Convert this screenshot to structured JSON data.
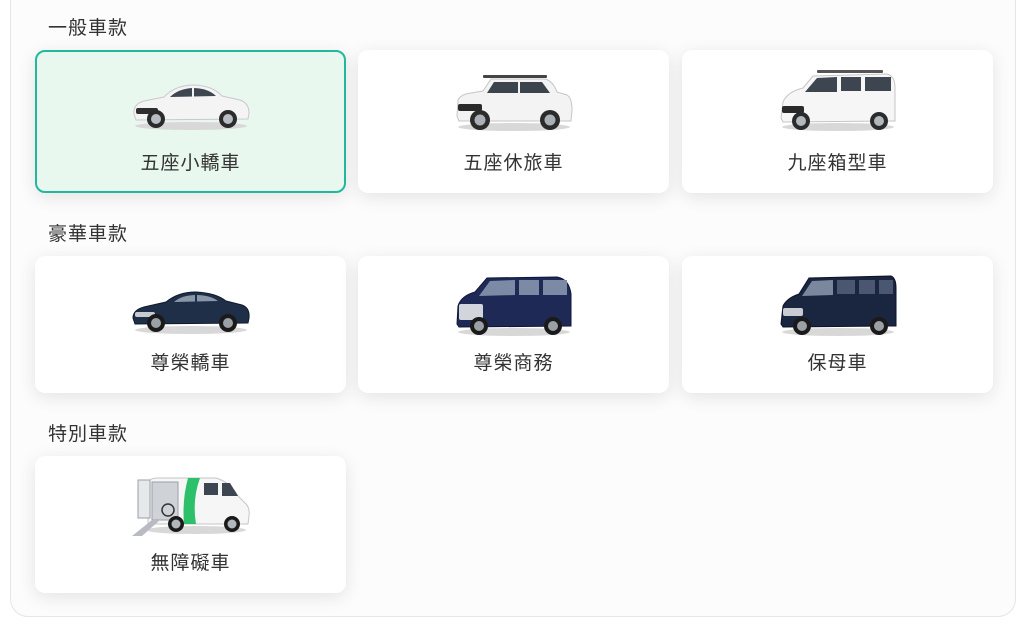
{
  "sections": [
    {
      "title": "一般車款",
      "cards": [
        {
          "label": "五座小轎車",
          "icon": "white-sedan-icon",
          "selected": true
        },
        {
          "label": "五座休旅車",
          "icon": "white-suv-icon",
          "selected": false
        },
        {
          "label": "九座箱型車",
          "icon": "white-van-icon",
          "selected": false
        }
      ]
    },
    {
      "title": "豪華車款",
      "cards": [
        {
          "label": "尊榮轎車",
          "icon": "luxury-sedan-icon",
          "selected": false
        },
        {
          "label": "尊榮商務",
          "icon": "luxury-mpv-icon",
          "selected": false
        },
        {
          "label": "保母車",
          "icon": "dark-van-icon",
          "selected": false
        }
      ]
    },
    {
      "title": "特別車款",
      "cards": [
        {
          "label": "無障礙車",
          "icon": "accessible-van-icon",
          "selected": false
        }
      ]
    }
  ],
  "colors": {
    "selected_border": "#22b8a0",
    "selected_background": "#e9f8ef",
    "text": "#333333"
  }
}
